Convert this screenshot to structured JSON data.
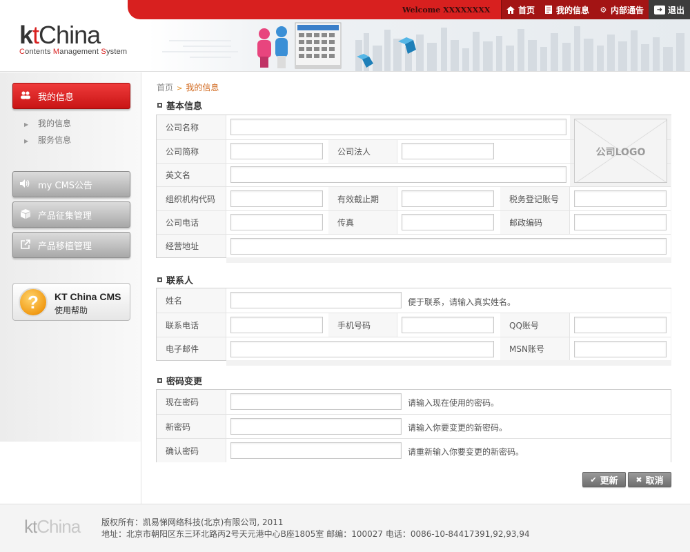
{
  "header": {
    "welcome": "Welcome XXXXXXXX",
    "nav": [
      {
        "label": "首页",
        "icon": "home-icon"
      },
      {
        "label": "我的信息",
        "icon": "document-icon"
      },
      {
        "label": "内部通告",
        "icon": "gear-icon"
      },
      {
        "label": "退出",
        "icon": "logout-icon"
      }
    ],
    "logo": {
      "k": "k",
      "t": "t",
      "china": "China",
      "sub_c": "C",
      "sub_1": "ontents ",
      "sub_m": "M",
      "sub_2": "anagement ",
      "sub_s": "S",
      "sub_3": "ystem"
    }
  },
  "sidebar": {
    "active": {
      "label": "我的信息",
      "icon": "users-icon"
    },
    "sub_items": [
      "我的信息",
      "服务信息"
    ],
    "buttons": [
      {
        "label": "my CMS公告",
        "icon": "speaker-icon"
      },
      {
        "label": "产品征集管理",
        "icon": "box-icon"
      },
      {
        "label": "产品移植管理",
        "icon": "external-link-icon"
      }
    ],
    "help": {
      "title": "KT China CMS",
      "subtitle": "使用帮助",
      "glyph": "?"
    }
  },
  "breadcrumb": {
    "home": "首页",
    "sep": ">",
    "current": "我的信息"
  },
  "sections": {
    "basic": {
      "title": "基本信息",
      "company_name": "公司名称",
      "short_name": "公司简称",
      "legal_person": "公司法人",
      "english_name": "英文名",
      "org_code": "组织机构代码",
      "valid_until": "有效截止期",
      "tax_no": "税务登记账号",
      "phone": "公司电话",
      "fax": "传真",
      "postcode": "邮政编码",
      "address": "经营地址",
      "logo_placeholder": "公司LOGO"
    },
    "contact": {
      "title": "联系人",
      "name": "姓名",
      "name_hint": "便于联系，请输入真实姓名。",
      "tel": "联系电话",
      "mobile": "手机号码",
      "qq": "QQ账号",
      "email": "电子邮件",
      "msn": "MSN账号"
    },
    "password": {
      "title": "密码变更",
      "current": "现在密码",
      "current_hint": "请输入现在使用的密码。",
      "new": "新密码",
      "new_hint": "请输入你要变更的新密码。",
      "confirm": "确认密码",
      "confirm_hint": "请重新输入你要变更的新密码。"
    }
  },
  "actions": {
    "update": "更新",
    "cancel": "取消"
  },
  "footer": {
    "logo_k": "kt",
    "logo_china": "China",
    "copyright": "版权所有：凯易悌网络科技(北京)有限公司, 2011",
    "address": "地址：北京市朝阳区东三环北路丙2号天元港中心B座1805室 邮编：100027 电话：0086-10-84417391,92,93,94"
  },
  "colors": {
    "brand_red": "#d8201f",
    "button_gray": "#8a8a8a"
  }
}
